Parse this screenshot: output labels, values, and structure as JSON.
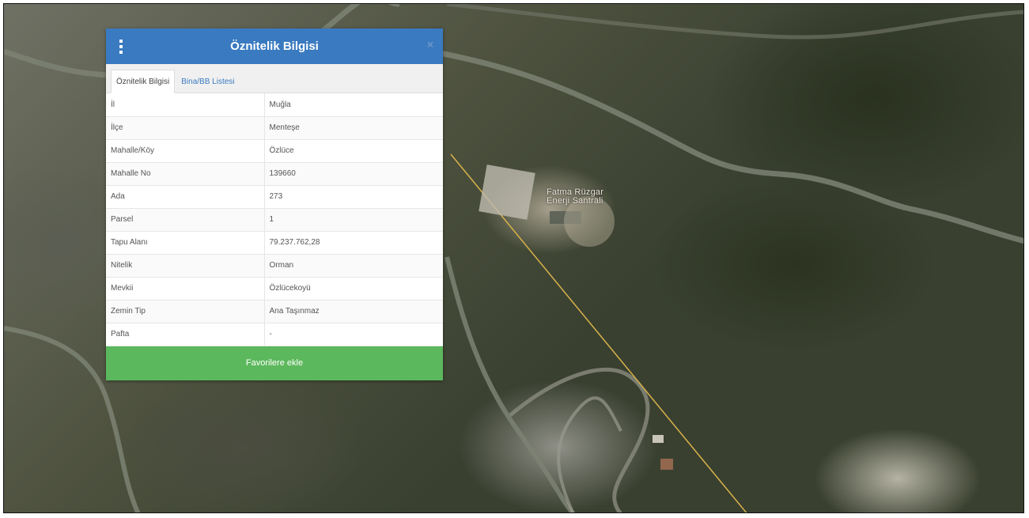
{
  "map": {
    "place_label": "Fatma Rüzgar Enerji Santrali",
    "colors": {
      "forest": "#3a402f",
      "road": "#7d8273",
      "boundary": "#d8b24a"
    }
  },
  "dialog": {
    "title": "Öznitelik Bilgisi",
    "menu_icon": "vertical-dots-icon",
    "close_icon": "close-icon",
    "close_glyph": "×",
    "header_color": "#3a7ac0",
    "tabs": [
      {
        "label": "Öznitelik Bilgisi",
        "active": true
      },
      {
        "label": "Bina/BB Listesi",
        "active": false
      }
    ],
    "rows": [
      {
        "key": "İl",
        "value": "Muğla"
      },
      {
        "key": "İlçe",
        "value": "Menteşe"
      },
      {
        "key": "Mahalle/Köy",
        "value": "Özlüce"
      },
      {
        "key": "Mahalle No",
        "value": "139660"
      },
      {
        "key": "Ada",
        "value": "273"
      },
      {
        "key": "Parsel",
        "value": "1"
      },
      {
        "key": "Tapu Alanı",
        "value": "79.237.762,28"
      },
      {
        "key": "Nitelik",
        "value": "Orman"
      },
      {
        "key": "Mevkii",
        "value": "Özlücekoyü"
      },
      {
        "key": "Zemin Tip",
        "value": "Ana Taşınmaz"
      },
      {
        "key": "Pafta",
        "value": "-"
      }
    ],
    "favorite_button_label": "Favorilere ekle",
    "favorite_button_color": "#5cb85c"
  }
}
